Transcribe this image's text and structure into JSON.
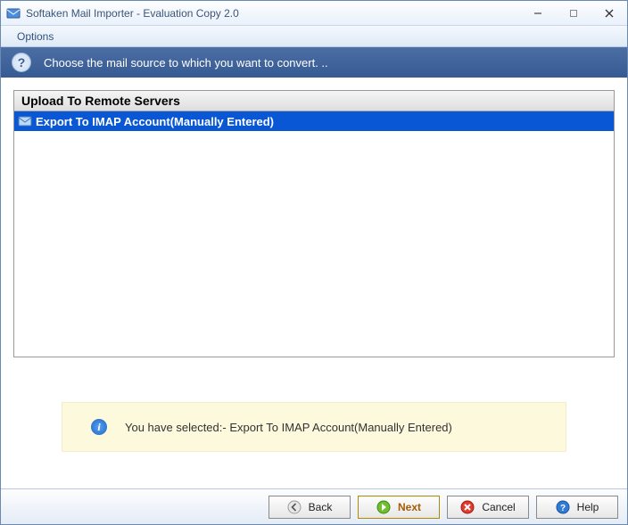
{
  "window": {
    "title": "Softaken Mail Importer - Evaluation Copy 2.0"
  },
  "menubar": {
    "options": "Options"
  },
  "instruction": "Choose the mail source to which you want to convert. ..",
  "list": {
    "header": "Upload To Remote Servers",
    "items": [
      {
        "label": "Export To IMAP Account(Manually Entered)",
        "selected": true
      }
    ]
  },
  "notice": {
    "text": "You have selected:- Export To IMAP Account(Manually Entered)"
  },
  "buttons": {
    "back": "Back",
    "next": "Next",
    "cancel": "Cancel",
    "help": "Help"
  }
}
